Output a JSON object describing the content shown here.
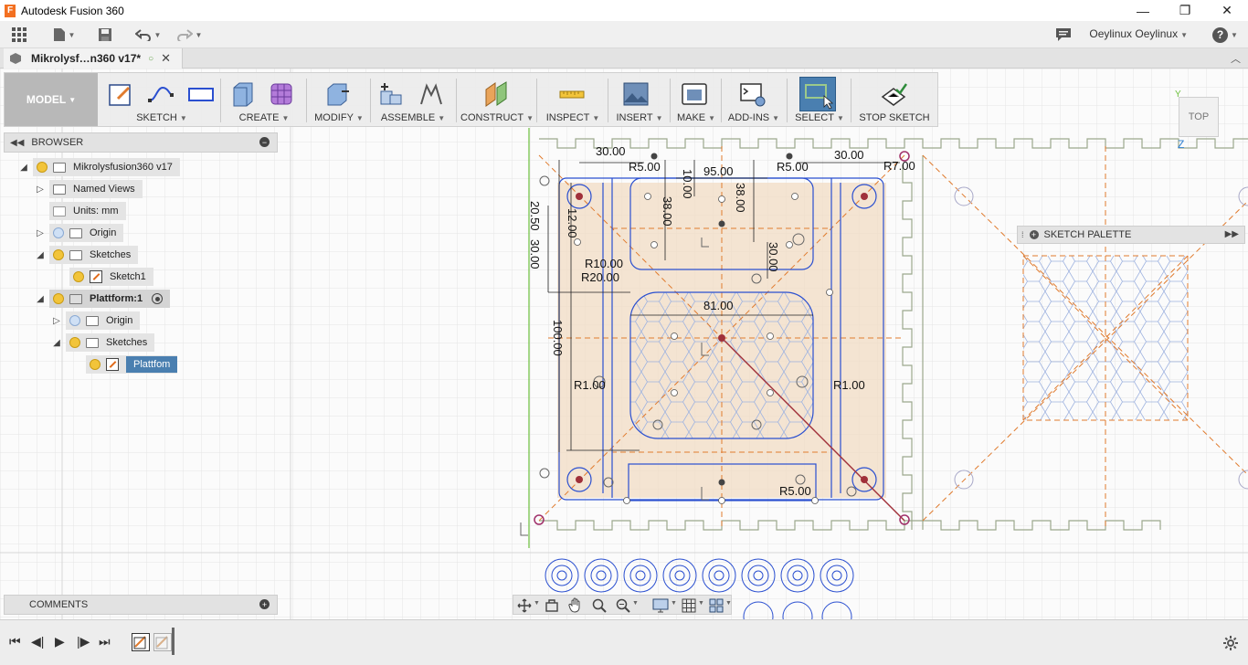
{
  "window": {
    "title": "Autodesk Fusion 360",
    "app_icon_letter": "F",
    "minimize": "—",
    "restore": "❐",
    "close": "✕"
  },
  "quick_access": {
    "user": "Oeylinux Oeylinux",
    "help": "?"
  },
  "document_tab": {
    "name": "Mikrolysf…n360 v17*"
  },
  "ribbon": {
    "workspace": "MODEL",
    "groups": [
      {
        "label": "SKETCH"
      },
      {
        "label": "CREATE"
      },
      {
        "label": "MODIFY"
      },
      {
        "label": "ASSEMBLE"
      },
      {
        "label": "CONSTRUCT"
      },
      {
        "label": "INSPECT"
      },
      {
        "label": "INSERT"
      },
      {
        "label": "MAKE"
      },
      {
        "label": "ADD-INS"
      },
      {
        "label": "SELECT"
      },
      {
        "label": "STOP SKETCH"
      }
    ]
  },
  "browser": {
    "title": "BROWSER",
    "items": [
      {
        "label": "Mikrolysfusion360 v17"
      },
      {
        "label": "Named Views"
      },
      {
        "label": "Units: mm"
      },
      {
        "label": "Origin"
      },
      {
        "label": "Sketches"
      },
      {
        "label": "Sketch1"
      },
      {
        "label": "Plattform:1"
      },
      {
        "label": "Origin"
      },
      {
        "label": "Sketches"
      },
      {
        "label": "Plattfom"
      }
    ]
  },
  "comments": {
    "title": "COMMENTS"
  },
  "sketch_palette": {
    "title": "SKETCH PALETTE"
  },
  "viewcube": {
    "face": "TOP"
  },
  "dimensions": {
    "d1": "30.00",
    "d2": "R5.00",
    "d3": "95.00",
    "d4": "R5.00",
    "d5": "30.00",
    "d6": "R7.00",
    "d7": "10.00",
    "d8": "38.00",
    "d9": "38.00",
    "d10": "12.00",
    "d11": "20.50",
    "d12": "30.00",
    "d13": "R10.00",
    "d14": "R20.00",
    "d15": "30.00",
    "d16": "81.00",
    "d17": "100.00",
    "d18": "R1.00",
    "d19": "R1.00",
    "d20": "R5.00"
  },
  "colors": {
    "accent": "#2f7fd0",
    "sketch_line": "#2a4fd0",
    "construction": "#e07b2e",
    "selected": "#4a7fb0"
  }
}
